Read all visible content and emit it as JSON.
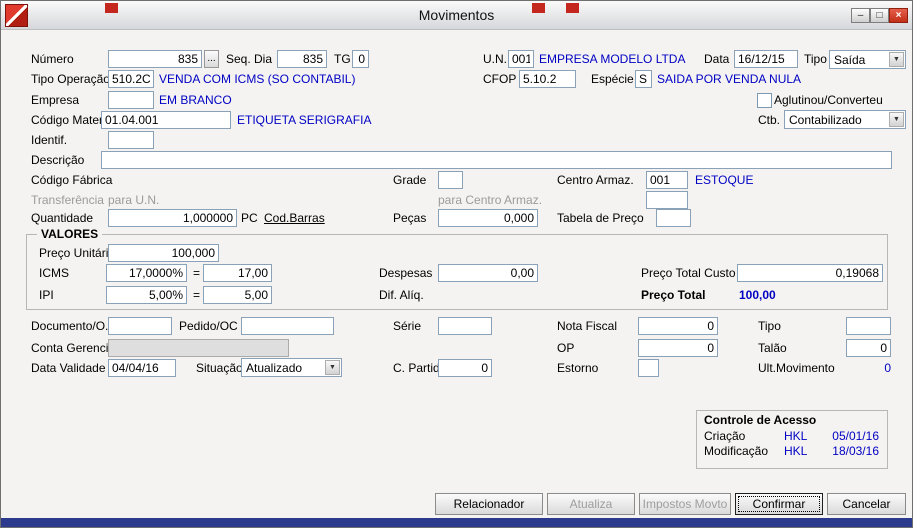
{
  "window": {
    "title": "Movimentos",
    "minimize": "–",
    "maximize": "□",
    "close": "×"
  },
  "icons": {
    "dropdown_arrow": "▼"
  },
  "fields": {
    "numero": {
      "label": "Número",
      "value": "835",
      "browse": "..."
    },
    "seq_dia": {
      "label": "Seq. Dia",
      "value": "835"
    },
    "tg": {
      "label": "TG",
      "value": "0"
    },
    "un": {
      "label": "U.N.",
      "value": "001",
      "display": "EMPRESA MODELO LTDA"
    },
    "data": {
      "label": "Data",
      "value": "16/12/15"
    },
    "tipo": {
      "label": "Tipo",
      "value": "Saída"
    },
    "tipo_operacao": {
      "label": "Tipo Operação",
      "value": "510.2C",
      "display": "VENDA COM ICMS (SO CONTABIL)"
    },
    "cfop": {
      "label": "CFOP",
      "value": "5.10.2"
    },
    "especie": {
      "label": "Espécie",
      "value": "S",
      "display": "SAIDA POR VENDA NULA"
    },
    "empresa": {
      "label": "Empresa",
      "value": "",
      "display": "EM BRANCO"
    },
    "aglutinou": {
      "label": "Aglutinou/Converteu"
    },
    "codigo_material": {
      "label": "Código Material",
      "value": "01.04.001",
      "display": "ETIQUETA SERIGRAFIA"
    },
    "ctb": {
      "label": "Ctb.",
      "value": "Contabilizado"
    },
    "identif": {
      "label": "Identif.",
      "value": ""
    },
    "descricao": {
      "label": "Descrição",
      "value": ""
    },
    "codigo_fabrica": {
      "label": "Código Fábrica"
    },
    "grade": {
      "label": "Grade",
      "value": ""
    },
    "centro_armaz": {
      "label": "Centro Armaz.",
      "value": "001",
      "display": "ESTOQUE",
      "value2": ""
    },
    "transferencia": {
      "label": "Transferência",
      "para_un": "para U.N.",
      "para_centro": "para Centro Armaz."
    },
    "quantidade": {
      "label": "Quantidade",
      "value": "1,000000",
      "unit": "PC",
      "link": "Cod.Barras"
    },
    "pecas": {
      "label": "Peças",
      "value": "0,000"
    },
    "tabela_preco": {
      "label": "Tabela de Preço",
      "value": ""
    },
    "documento_os": {
      "label": "Documento/O.S",
      "value": ""
    },
    "pedido_oc": {
      "label": "Pedido/OC",
      "value": ""
    },
    "serie": {
      "label": "Série",
      "value": ""
    },
    "nota_fiscal": {
      "label": "Nota Fiscal",
      "value": "0"
    },
    "tipo_nf": {
      "label": "Tipo",
      "value": ""
    },
    "conta_gerencial": {
      "label": "Conta Gerencial",
      "value": ""
    },
    "op": {
      "label": "OP",
      "value": "0"
    },
    "talao": {
      "label": "Talão",
      "value": "0"
    },
    "data_validade": {
      "label": "Data Validade",
      "value": "04/04/16"
    },
    "situacao": {
      "label": "Situação",
      "value": "Atualizado"
    },
    "c_partida": {
      "label": "C. Partida",
      "value": "0"
    },
    "estorno": {
      "label": "Estorno",
      "value": ""
    },
    "ult_movimento": {
      "label": "Ult.Movimento",
      "value": "0"
    }
  },
  "valores": {
    "title": "VALORES",
    "preco_unitario": {
      "label": "Preço Unitário",
      "value": "100,000"
    },
    "icms": {
      "label": "ICMS",
      "pct": "17,0000%",
      "eq": "=",
      "value": "17,00"
    },
    "ipi": {
      "label": "IPI",
      "pct": "5,00%",
      "eq": "=",
      "value": "5,00"
    },
    "despesas": {
      "label": "Despesas",
      "value": "0,00"
    },
    "dif_aliq": {
      "label": "Dif. Alíq."
    },
    "preco_total_custo": {
      "label": "Preço Total Custo",
      "value": "0,19068"
    },
    "preco_total": {
      "label": "Preço Total",
      "value": "100,00"
    }
  },
  "acesso": {
    "title": "Controle de Acesso",
    "criacao": {
      "label": "Criação",
      "user": "HKL",
      "date": "05/01/16"
    },
    "modificacao": {
      "label": "Modificação",
      "user": "HKL",
      "date": "18/03/16"
    }
  },
  "buttons": {
    "relacionador": "Relacionador",
    "atualiza": "Atualiza",
    "impostos_movto": "Impostos Movto",
    "confirmar": "Confirmar",
    "cancelar": "Cancelar"
  }
}
